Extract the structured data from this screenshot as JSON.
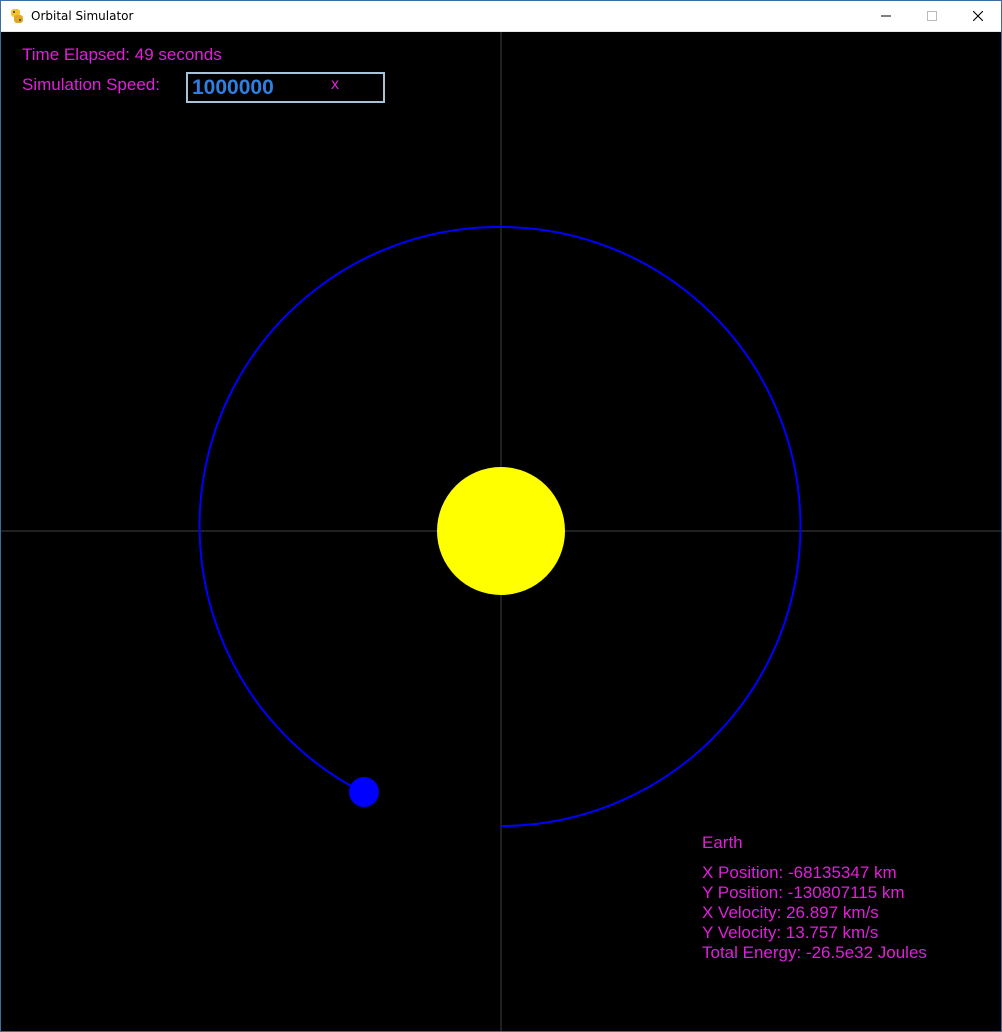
{
  "window": {
    "title": "Orbital Simulator",
    "app_icon": "python-snake-icon",
    "controls": [
      "minimize-icon",
      "maximize-icon",
      "close-icon"
    ]
  },
  "hud": {
    "time_elapsed": "Time Elapsed: 49 seconds",
    "speed_label": "Simulation Speed:",
    "speed_value": "1000000",
    "speed_suffix": "x"
  },
  "info": {
    "body_name": "Earth",
    "x_position": "X Position: -68135347 km",
    "y_position": "Y Position: -130807115 km",
    "x_velocity": "X Velocity: 26.897 km/s",
    "y_velocity": "Y Velocity: 13.757 km/s",
    "total_energy": "Total Energy: -26.5e32 Joules"
  },
  "colors": {
    "background": "#000000",
    "text": "#e020d8",
    "sun": "#ffff00",
    "planet": "#0000ff",
    "orbit": "#0000ff",
    "axes": "#404040",
    "speed_value": "#2f7fe0"
  }
}
